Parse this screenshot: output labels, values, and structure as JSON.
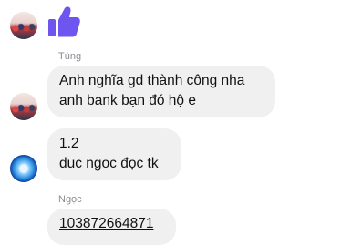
{
  "colors": {
    "bubble_background": "#f0f0f0",
    "sender_name": "#8a8d91",
    "like_icon": "#6e55f0"
  },
  "messages": [
    {
      "sender": "",
      "avatar": "group-photo",
      "reaction": "thumbs-up-icon"
    },
    {
      "sender": "Tùng",
      "avatar": "group-photo",
      "lines": [
        "Anh nghĩa gd thành công nha",
        "anh bank bạn đó hộ e"
      ]
    },
    {
      "sender": "",
      "avatar": "globe",
      "lines": [
        "1.2",
        "duc ngoc đọc tk"
      ]
    },
    {
      "sender": "Ngọc",
      "lines": [
        "103872664871"
      ]
    }
  ]
}
